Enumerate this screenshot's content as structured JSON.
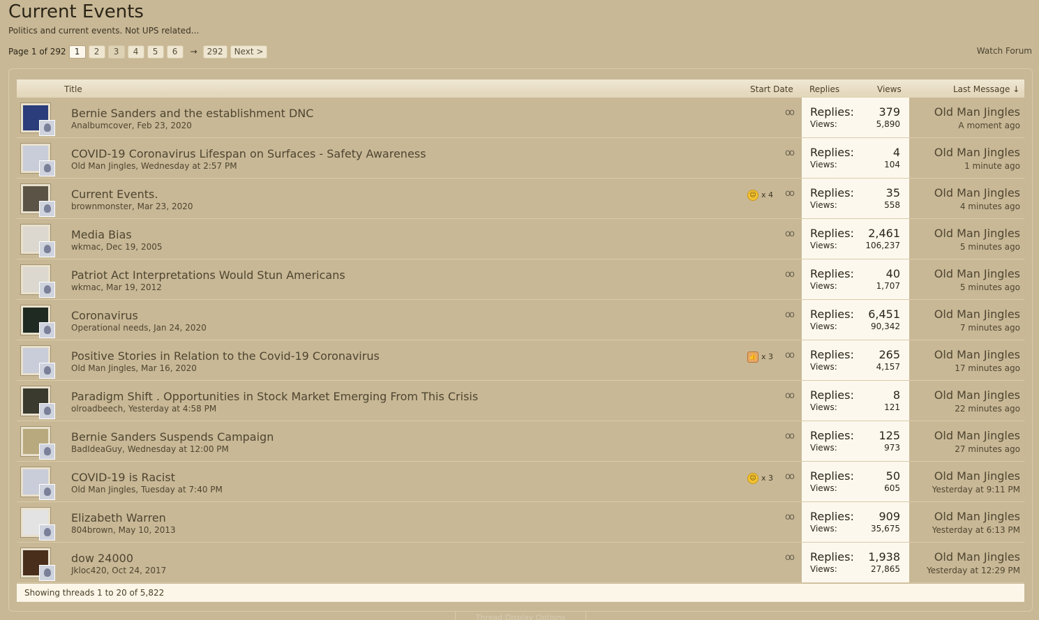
{
  "page": {
    "title": "Current Events",
    "subtitle": "Politics and current events. Not UPS related...",
    "watch_label": "Watch Forum"
  },
  "pagination": {
    "label": "Page 1 of 292",
    "pages": [
      "1",
      "2",
      "3",
      "4",
      "5",
      "6"
    ],
    "arrow": "→",
    "last": "292",
    "next": "Next >"
  },
  "table": {
    "headers": {
      "title": "Title",
      "start_date": "Start Date",
      "replies": "Replies",
      "views": "Views",
      "last_message": "Last Message ↓"
    },
    "replies_label": "Replies:",
    "views_label": "Views:",
    "threads": [
      {
        "title": "Bernie Sanders and the establishment DNC",
        "meta": "Analbumcover, Feb 23, 2020",
        "replies": "379",
        "views": "5,890",
        "last_user": "Old Man Jingles",
        "last_time": "A moment ago",
        "avatar_color": "#2b3d7a",
        "reaction": "",
        "reaction_count": ""
      },
      {
        "title": "COVID-19 Coronavirus Lifespan on Surfaces - Safety Awareness",
        "meta": "Old Man Jingles, Wednesday at 2:57 PM",
        "replies": "4",
        "views": "104",
        "last_user": "Old Man Jingles",
        "last_time": "1 minute ago",
        "avatar_color": "#c9ccd9",
        "reaction": "",
        "reaction_count": ""
      },
      {
        "title": "Current Events.",
        "meta": "brownmonster, Mar 23, 2020",
        "replies": "35",
        "views": "558",
        "last_user": "Old Man Jingles",
        "last_time": "4 minutes ago",
        "avatar_color": "#5b5446",
        "reaction": "smile",
        "reaction_count": "x 4"
      },
      {
        "title": "Media Bias",
        "meta": "wkmac, Dec 19, 2005",
        "replies": "2,461",
        "views": "106,237",
        "last_user": "Old Man Jingles",
        "last_time": "5 minutes ago",
        "avatar_color": "#dcd8cf",
        "reaction": "",
        "reaction_count": ""
      },
      {
        "title": "Patriot Act Interpretations Would Stun Americans",
        "meta": "wkmac, Mar 19, 2012",
        "replies": "40",
        "views": "1,707",
        "last_user": "Old Man Jingles",
        "last_time": "5 minutes ago",
        "avatar_color": "#dcd8cf",
        "reaction": "",
        "reaction_count": ""
      },
      {
        "title": "Coronavirus",
        "meta": "Operational needs, Jan 24, 2020",
        "replies": "6,451",
        "views": "90,342",
        "last_user": "Old Man Jingles",
        "last_time": "7 minutes ago",
        "avatar_color": "#1e2a22",
        "reaction": "",
        "reaction_count": ""
      },
      {
        "title": "Positive Stories in Relation to the Covid-19 Coronavirus",
        "meta": "Old Man Jingles, Mar 16, 2020",
        "replies": "265",
        "views": "4,157",
        "last_user": "Old Man Jingles",
        "last_time": "17 minutes ago",
        "avatar_color": "#c9ccd9",
        "reaction": "like",
        "reaction_count": "x 3"
      },
      {
        "title": "Paradigm Shift . Opportunities in Stock Market Emerging From This Crisis",
        "meta": "olroadbeech, Yesterday at 4:58 PM",
        "replies": "8",
        "views": "121",
        "last_user": "Old Man Jingles",
        "last_time": "22 minutes ago",
        "avatar_color": "#3a3a2e",
        "reaction": "",
        "reaction_count": ""
      },
      {
        "title": "Bernie Sanders Suspends Campaign",
        "meta": "BadIdeaGuy, Wednesday at 12:00 PM",
        "replies": "125",
        "views": "973",
        "last_user": "Old Man Jingles",
        "last_time": "27 minutes ago",
        "avatar_color": "#b9a97f",
        "reaction": "",
        "reaction_count": ""
      },
      {
        "title": "COVID-19 is Racist",
        "meta": "Old Man Jingles, Tuesday at 7:40 PM",
        "replies": "50",
        "views": "605",
        "last_user": "Old Man Jingles",
        "last_time": "Yesterday at 9:11 PM",
        "avatar_color": "#c9ccd9",
        "reaction": "smile",
        "reaction_count": "x 3"
      },
      {
        "title": "Elizabeth Warren",
        "meta": "804brown, May 10, 2013",
        "replies": "909",
        "views": "35,675",
        "last_user": "Old Man Jingles",
        "last_time": "Yesterday at 6:13 PM",
        "avatar_color": "#e3e3e3",
        "reaction": "",
        "reaction_count": ""
      },
      {
        "title": "dow 24000",
        "meta": "Jkloc420, Oct 24, 2017",
        "replies": "1,938",
        "views": "27,865",
        "last_user": "Old Man Jingles",
        "last_time": "Yesterday at 12:29 PM",
        "avatar_color": "#4a2e1c",
        "reaction": "",
        "reaction_count": ""
      }
    ]
  },
  "footer": {
    "showing": "Showing threads 1 to 20 of 5,822",
    "options": "Thread Display Options"
  }
}
